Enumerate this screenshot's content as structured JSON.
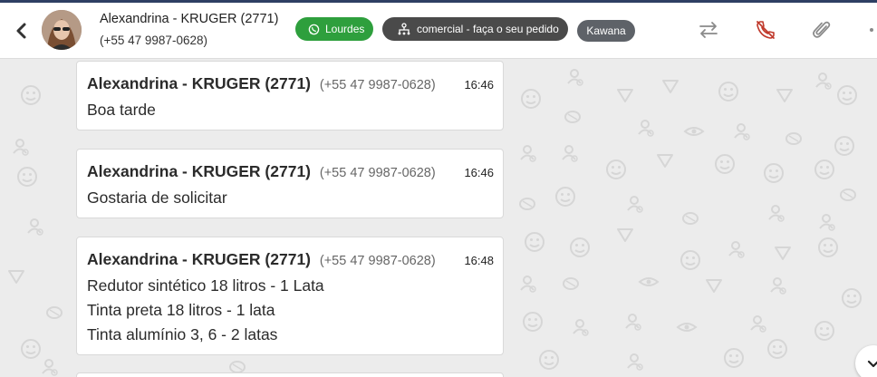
{
  "header": {
    "contact_name": "Alexandrina - KRUGER (2771)",
    "contact_phone": "(+55 47 9987-0628)",
    "tags": {
      "whatsapp": "Lourdes",
      "department": "comercial - faça o seu pedido",
      "agent": "Kawana"
    },
    "icons": [
      "back-arrow-icon",
      "transfer-icon",
      "end-call-icon",
      "attach-icon",
      "more-icon"
    ]
  },
  "messages": [
    {
      "sender": "Alexandrina - KRUGER (2771)",
      "phone": "(+55 47 9987-0628)",
      "time": "16:46",
      "lines": [
        "Boa tarde"
      ]
    },
    {
      "sender": "Alexandrina - KRUGER (2771)",
      "phone": "(+55 47 9987-0628)",
      "time": "16:46",
      "lines": [
        "Gostaria de solicitar"
      ]
    },
    {
      "sender": "Alexandrina - KRUGER (2771)",
      "phone": "(+55 47 9987-0628)",
      "time": "16:48",
      "lines": [
        "Redutor sintético 18 litros - 1 Lata",
        "Tinta preta 18 litros - 1 lata",
        "Tinta alumínio 3, 6 - 2 latas"
      ]
    }
  ],
  "colors": {
    "whatsapp_tag": "#2e9f3d",
    "department_tag": "#4a4a4a",
    "agent_tag": "#5e6268",
    "end_call_icon": "#c0392b",
    "chat_background": "#ececec"
  }
}
